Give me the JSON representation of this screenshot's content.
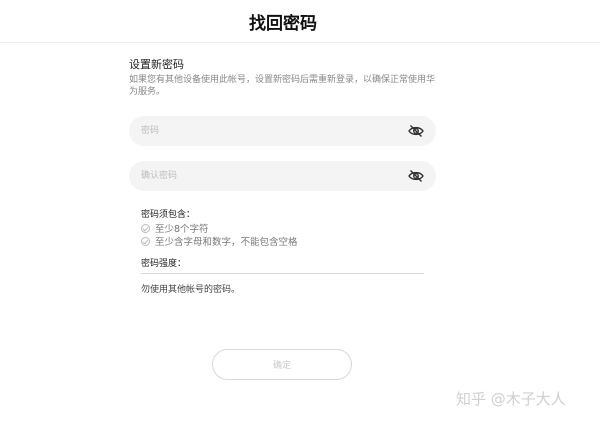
{
  "header": {
    "title": "找回密码"
  },
  "form": {
    "section_title": "设置新密码",
    "description": "如果您有其他设备使用此帐号，设置新密码后需重新登录，以确保正常使用华为服务。",
    "password": {
      "placeholder": "密码",
      "value": ""
    },
    "confirm_password": {
      "placeholder": "确认密码",
      "value": ""
    }
  },
  "rules": {
    "title": "密码须包含：",
    "items": [
      "至少8个字符",
      "至少含字母和数字，不能包含空格"
    ]
  },
  "strength": {
    "label": "密码强度："
  },
  "warning": "勿使用其他帐号的密码。",
  "confirm_button": {
    "label": "确定",
    "enabled": false
  },
  "watermark": "知乎 @木子大人",
  "icons": {
    "eye_hidden": "eye-off-icon"
  }
}
